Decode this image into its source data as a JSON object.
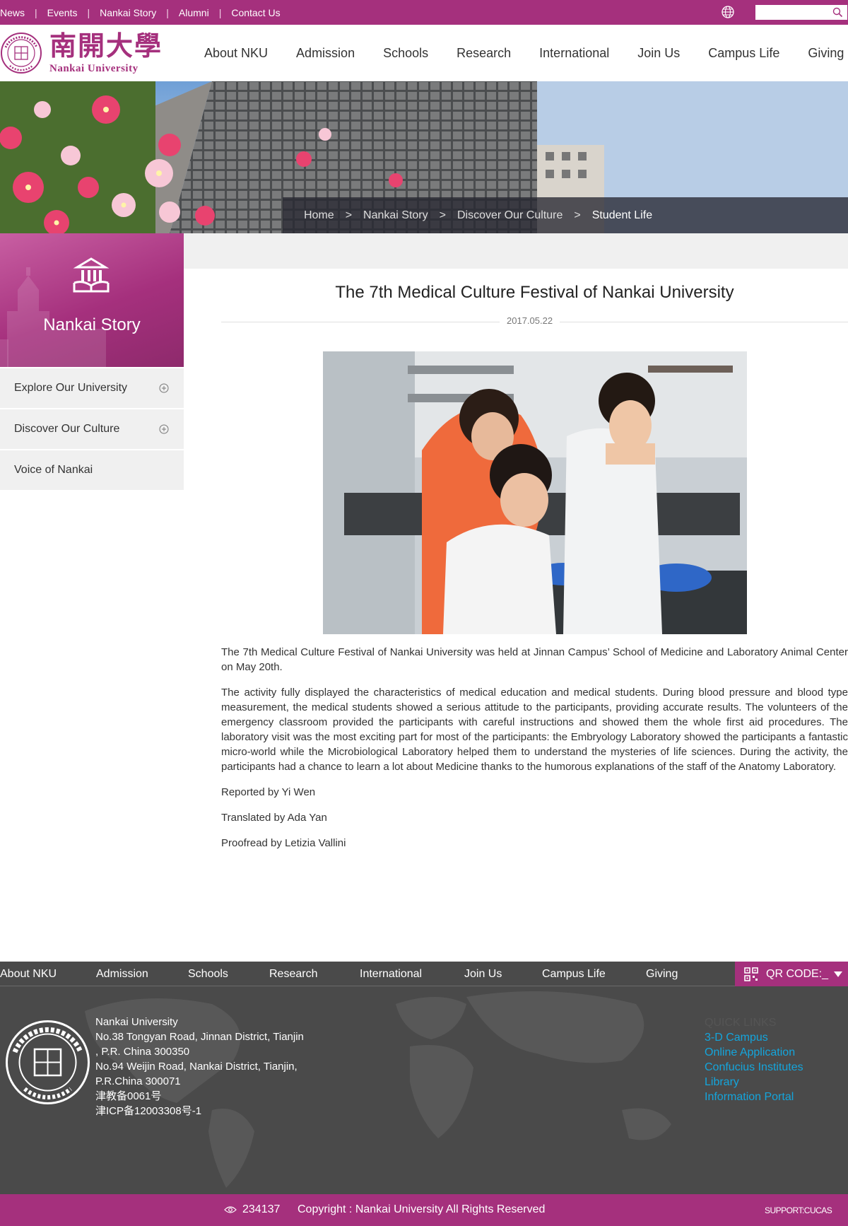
{
  "topbar": {
    "links": [
      "News",
      "Events",
      "Nankai Story",
      "Alumni",
      "Contact Us"
    ],
    "search_placeholder": ""
  },
  "header": {
    "logo_cn": "南開大學",
    "logo_en": "Nankai University",
    "nav": [
      "About NKU",
      "Admission",
      "Schools",
      "Research",
      "International",
      "Join Us",
      "Campus Life",
      "Giving"
    ]
  },
  "breadcrumb": {
    "items": [
      "Home",
      "Nankai Story",
      "Discover Our Culture",
      "Student Life"
    ],
    "separator": ">"
  },
  "sidebar": {
    "title": "Nankai Story",
    "items": [
      "Explore Our University",
      "Discover Our Culture",
      "Voice of Nankai"
    ]
  },
  "article": {
    "title": "The 7th Medical Culture Festival of Nankai University",
    "date": "2017.05.22",
    "paragraphs": [
      "The 7th Medical Culture Festival of Nankai University was held at Jinnan Campus’ School of Medicine and Laboratory Animal Center on May 20th.",
      "The activity fully displayed the characteristics of medical education and medical students. During blood pressure and blood type measurement, the medical students showed a serious attitude to the participants, providing accurate results. The volunteers of the emergency classroom provided the participants with careful instructions and showed them the whole first aid procedures. The laboratory visit was the most exciting part for most of the participants: the Embryology Laboratory showed the participants a fantastic micro-world while the Microbiological Laboratory helped them to understand the mysteries of life sciences. During the activity, the participants had a chance to learn a lot about Medicine thanks to the humorous explanations of the staff of the Anatomy Laboratory.",
      "Reported by Yi Wen",
      "Translated by Ada Yan",
      "Proofread by Letizia Vallini"
    ]
  },
  "footer": {
    "nav": [
      "About NKU",
      "Admission",
      "Schools",
      "Research",
      "International",
      "Join Us",
      "Campus Life",
      "Giving"
    ],
    "qr_label": "QR CODE:_",
    "address_lines": [
      "Nankai University",
      "No.38 Tongyan Road, Jinnan District, Tianjin",
      ", P.R. China 300350",
      "No.94 Weijin Road,  Nankai District, Tianjin,",
      "P.R.China  300071",
      "津教备0061号",
      "津ICP备12003308号-1"
    ],
    "quick_links_title": "QUICK LINKS",
    "quick_links": [
      "3-D Campus",
      "Online Application",
      "Confucius Institutes",
      "Library",
      "Information Portal"
    ],
    "visit_count": "234137",
    "copyright": "Copyright : Nankai University All Rights Reserved",
    "support": "SUPPORT:CUCAS"
  },
  "colors": {
    "brand_purple": "#a5307d",
    "link_blue": "#14a5dc",
    "footer_gray": "#4a4a4a",
    "sidebar_gray": "#f0f0f0"
  },
  "icons": [
    "globe-icon",
    "search-icon",
    "book-icon",
    "plus-circle-icon",
    "qr-code-icon",
    "caret-down-icon",
    "eye-icon"
  ]
}
